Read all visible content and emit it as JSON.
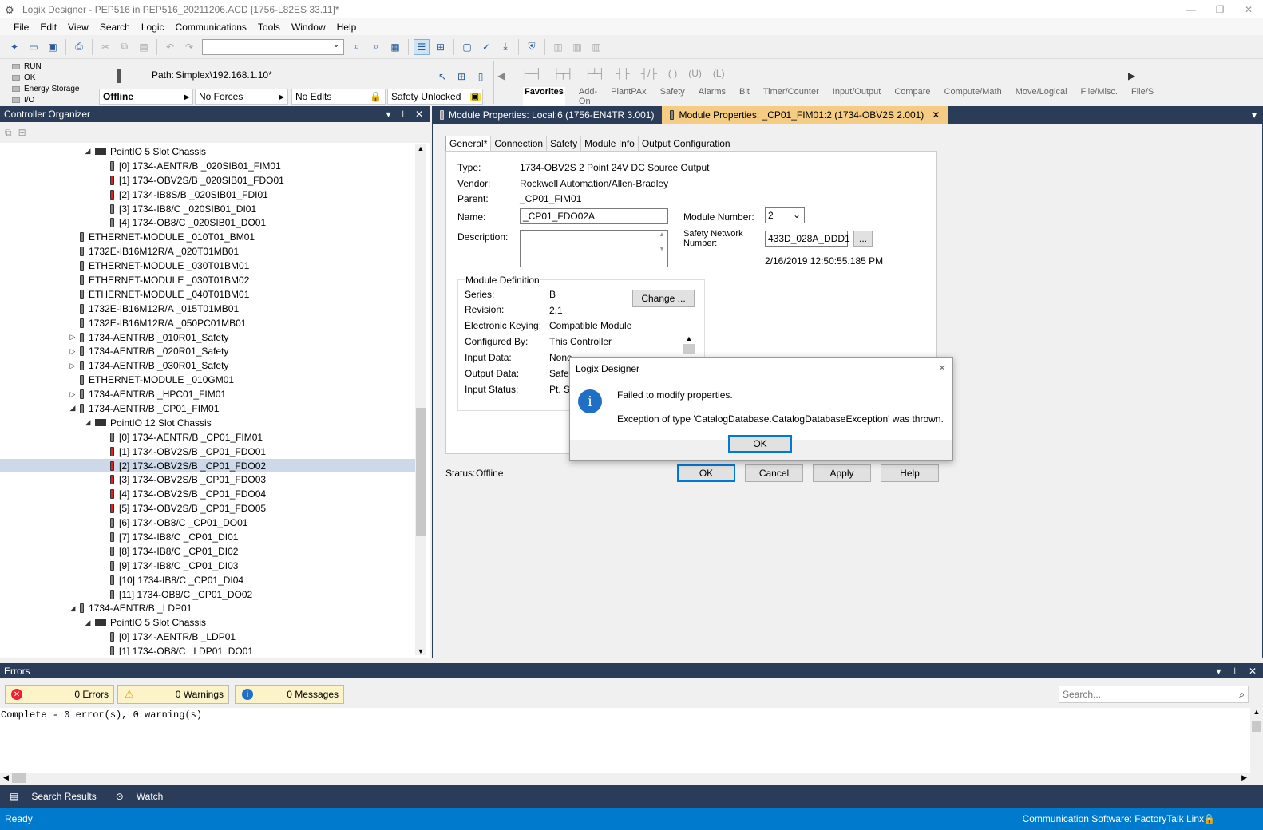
{
  "title": "Logix Designer - PEP516 in PEP516_20211206.ACD [1756-L82ES 33.11]*",
  "menu": [
    "File",
    "Edit",
    "View",
    "Search",
    "Logic",
    "Communications",
    "Tools",
    "Window",
    "Help"
  ],
  "status": {
    "leds": [
      "RUN",
      "OK",
      "Energy Storage",
      "I/O"
    ],
    "path_label": "Path:",
    "path_value": "Simplex\\192.168.1.10*",
    "mode": "Offline",
    "forces": "No Forces",
    "edits": "No Edits",
    "safety": "Safety Unlocked"
  },
  "instruction_tabs": [
    "Favorites",
    "Add-On",
    "PlantPAx",
    "Safety",
    "Alarms",
    "Bit",
    "Timer/Counter",
    "Input/Output",
    "Compare",
    "Compute/Math",
    "Move/Logical",
    "File/Misc.",
    "File/S"
  ],
  "organizer": {
    "title": "Controller Organizer",
    "rows": [
      {
        "indent": 2,
        "exp": "◢",
        "icon": "chassis",
        "text": "PointIO 5 Slot Chassis"
      },
      {
        "indent": 3,
        "exp": "",
        "icon": "mod",
        "text": "[0] 1734-AENTR/B _020SIB01_FIM01"
      },
      {
        "indent": 3,
        "exp": "",
        "icon": "red",
        "text": "[1] 1734-OBV2S/B _020SIB01_FDO01"
      },
      {
        "indent": 3,
        "exp": "",
        "icon": "red",
        "text": "[2] 1734-IB8S/B _020SIB01_FDI01"
      },
      {
        "indent": 3,
        "exp": "",
        "icon": "mod",
        "text": "[3] 1734-IB8/C _020SIB01_DI01"
      },
      {
        "indent": 3,
        "exp": "",
        "icon": "mod",
        "text": "[4] 1734-OB8/C _020SIB01_DO01"
      },
      {
        "indent": 1,
        "exp": "",
        "icon": "mod",
        "text": "ETHERNET-MODULE _010T01_BM01"
      },
      {
        "indent": 1,
        "exp": "",
        "icon": "mod",
        "text": "1732E-IB16M12R/A _020T01MB01"
      },
      {
        "indent": 1,
        "exp": "",
        "icon": "mod",
        "text": "ETHERNET-MODULE _030T01BM01"
      },
      {
        "indent": 1,
        "exp": "",
        "icon": "mod",
        "text": "ETHERNET-MODULE _030T01BM02"
      },
      {
        "indent": 1,
        "exp": "",
        "icon": "mod",
        "text": "ETHERNET-MODULE _040T01BM01"
      },
      {
        "indent": 1,
        "exp": "",
        "icon": "mod",
        "text": "1732E-IB16M12R/A _015T01MB01"
      },
      {
        "indent": 1,
        "exp": "",
        "icon": "mod",
        "text": "1732E-IB16M12R/A _050PC01MB01"
      },
      {
        "indent": 1,
        "exp": "▷",
        "icon": "mod",
        "text": "1734-AENTR/B _010R01_Safety"
      },
      {
        "indent": 1,
        "exp": "▷",
        "icon": "mod",
        "text": "1734-AENTR/B _020R01_Safety"
      },
      {
        "indent": 1,
        "exp": "▷",
        "icon": "mod",
        "text": "1734-AENTR/B _030R01_Safety"
      },
      {
        "indent": 1,
        "exp": "",
        "icon": "mod",
        "text": "ETHERNET-MODULE _010GM01"
      },
      {
        "indent": 1,
        "exp": "▷",
        "icon": "mod",
        "text": "1734-AENTR/B _HPC01_FIM01"
      },
      {
        "indent": 1,
        "exp": "◢",
        "icon": "mod",
        "text": "1734-AENTR/B _CP01_FIM01"
      },
      {
        "indent": 2,
        "exp": "◢",
        "icon": "chassis",
        "text": "PointIO 12 Slot Chassis"
      },
      {
        "indent": 3,
        "exp": "",
        "icon": "mod",
        "text": "[0] 1734-AENTR/B _CP01_FIM01"
      },
      {
        "indent": 3,
        "exp": "",
        "icon": "red",
        "text": "[1] 1734-OBV2S/B _CP01_FDO01"
      },
      {
        "indent": 3,
        "exp": "",
        "icon": "red",
        "text": "[2] 1734-OBV2S/B _CP01_FDO02",
        "selected": true
      },
      {
        "indent": 3,
        "exp": "",
        "icon": "red",
        "text": "[3] 1734-OBV2S/B _CP01_FDO03"
      },
      {
        "indent": 3,
        "exp": "",
        "icon": "red",
        "text": "[4] 1734-OBV2S/B _CP01_FDO04"
      },
      {
        "indent": 3,
        "exp": "",
        "icon": "red",
        "text": "[5] 1734-OBV2S/B _CP01_FDO05"
      },
      {
        "indent": 3,
        "exp": "",
        "icon": "mod",
        "text": "[6] 1734-OB8/C _CP01_DO01"
      },
      {
        "indent": 3,
        "exp": "",
        "icon": "mod",
        "text": "[7] 1734-IB8/C _CP01_DI01"
      },
      {
        "indent": 3,
        "exp": "",
        "icon": "mod",
        "text": "[8] 1734-IB8/C _CP01_DI02"
      },
      {
        "indent": 3,
        "exp": "",
        "icon": "mod",
        "text": "[9] 1734-IB8/C _CP01_DI03"
      },
      {
        "indent": 3,
        "exp": "",
        "icon": "mod",
        "text": "[10] 1734-IB8/C _CP01_DI04"
      },
      {
        "indent": 3,
        "exp": "",
        "icon": "mod",
        "text": "[11] 1734-OB8/C _CP01_DO02"
      },
      {
        "indent": 1,
        "exp": "◢",
        "icon": "mod",
        "text": "1734-AENTR/B _LDP01"
      },
      {
        "indent": 2,
        "exp": "◢",
        "icon": "chassis",
        "text": "PointIO 5 Slot Chassis"
      },
      {
        "indent": 3,
        "exp": "",
        "icon": "mod",
        "text": "[0] 1734-AENTR/B _LDP01"
      },
      {
        "indent": 3,
        "exp": "",
        "icon": "mod",
        "text": "[1] 1734-OB8/C _LDP01_DO01"
      }
    ]
  },
  "doc_tabs": [
    {
      "label": "Module Properties: Local:6 (1756-EN4TR 3.001)"
    },
    {
      "label": "Module Properties: _CP01_FIM01:2 (1734-OBV2S 2.001)"
    }
  ],
  "props": {
    "tabs": [
      "General*",
      "Connection",
      "Safety",
      "Module Info",
      "Output Configuration"
    ],
    "type_label": "Type:",
    "type_value": "1734-OBV2S 2 Point 24V DC Source Output",
    "vendor_label": "Vendor:",
    "vendor_value": "Rockwell Automation/Allen-Bradley",
    "parent_label": "Parent:",
    "parent_value": "_CP01_FIM01",
    "name_label": "Name:",
    "name_value": "_CP01_FDO02A",
    "desc_label": "Description:",
    "modnum_label": "Module Number:",
    "modnum_value": "2",
    "snn_label_1": "Safety Network",
    "snn_label_2": "Number:",
    "snn_value": "433D_028A_DDD1",
    "snn_btn": "...",
    "snn_date": "2/16/2019 12:50:55.185 PM",
    "def_title": "Module Definition",
    "series_label": "Series:",
    "series_value": "B",
    "revision_label": "Revision:",
    "revision_value": "2.1",
    "keying_label": "Electronic Keying:",
    "keying_value": "Compatible Module",
    "configby_label": "Configured By:",
    "configby_value": "This Controller",
    "indata_label": "Input Data:",
    "indata_value": "None",
    "outdata_label": "Output Data:",
    "outdata_value": "Safet",
    "instatus_label": "Input Status:",
    "instatus_value": "Pt. St",
    "change_btn": "Change ...",
    "status_label": "Status:",
    "status_value": "Offline",
    "ok": "OK",
    "cancel": "Cancel",
    "apply": "Apply",
    "help": "Help"
  },
  "msgbox": {
    "title": "Logix Designer",
    "line1": "Failed to modify properties.",
    "line2": "Exception of type 'CatalogDatabase.CatalogDatabaseException' was thrown.",
    "ok": "OK"
  },
  "errors": {
    "title": "Errors",
    "errors_count": "0 Errors",
    "warnings_count": "0 Warnings",
    "messages_count": "0 Messages",
    "search_placeholder": "Search...",
    "output": "Complete - 0 error(s), 0 warning(s)"
  },
  "bottom_tabs": [
    "Search Results",
    "Watch"
  ],
  "statusbar": {
    "left": "Ready",
    "right": "Communication Software: FactoryTalk Linx"
  }
}
